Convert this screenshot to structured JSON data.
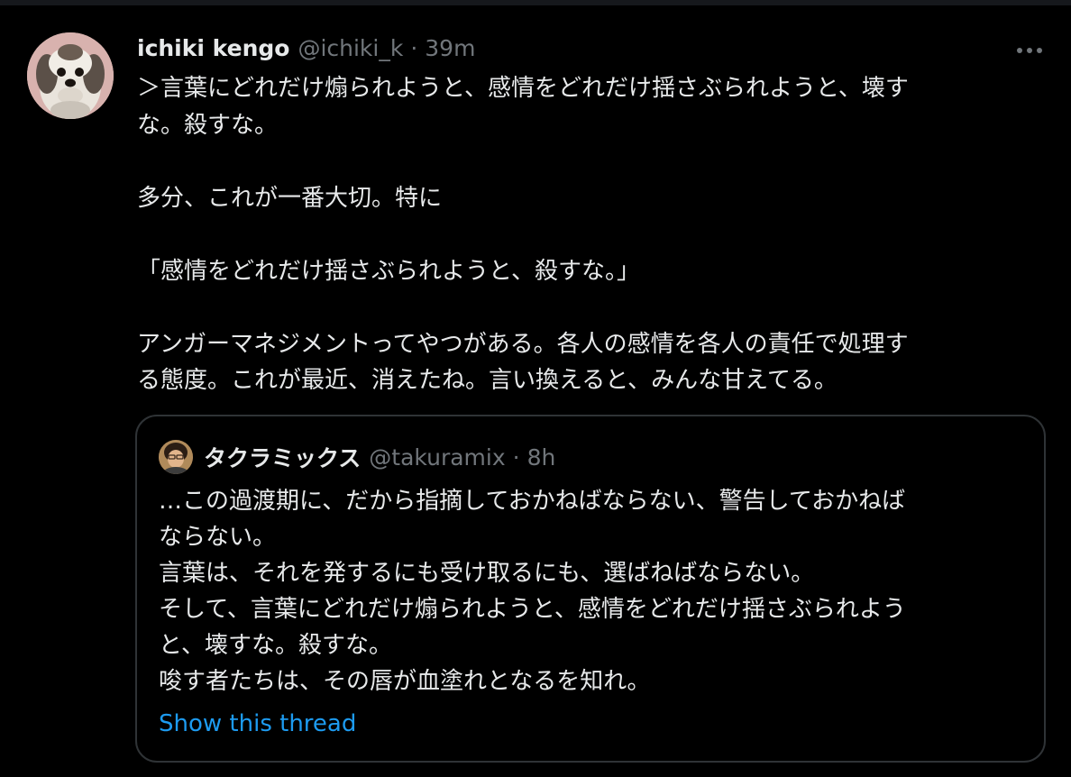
{
  "tweet": {
    "author": {
      "display_name": "ichiki kengo",
      "handle": "@ichiki_k",
      "separator": "·",
      "time": "39m",
      "avatar_icon": "dog-avatar"
    },
    "more_icon": "more-options-icon",
    "text_lines": [
      "＞言葉にどれだけ煽られようと、感情をどれだけ揺さぶられようと、壊す",
      "な。殺すな。",
      "",
      "多分、これが一番大切。特に",
      "",
      "「感情をどれだけ揺さぶられようと、殺すな。」",
      "",
      "アンガーマネジメントってやつがある。各人の感情を各人の責任で処理す",
      "る態度。これが最近、消えたね。言い換えると、みんな甘えてる。"
    ]
  },
  "quote": {
    "author": {
      "display_name": "タクラミックス",
      "handle": "@takuramix",
      "separator": "·",
      "time": "8h",
      "avatar_icon": "person-avatar"
    },
    "text_lines": [
      "…この過渡期に、だから指摘しておかねばならない、警告しておかねば",
      "ならない。",
      "言葉は、それを発するにも受け取るにも、選ばねばならない。",
      "そして、言葉にどれだけ煽られようと、感情をどれだけ揺さぶられよう",
      "と、壊すな。殺すな。",
      "唆す者たちは、その唇が血塗れとなるを知れ。"
    ],
    "show_thread_label": "Show this thread"
  },
  "colors": {
    "background": "#000000",
    "text_primary": "#e7e9ea",
    "text_secondary": "#71767b",
    "link": "#1d9bf0",
    "border": "#2f3336"
  }
}
